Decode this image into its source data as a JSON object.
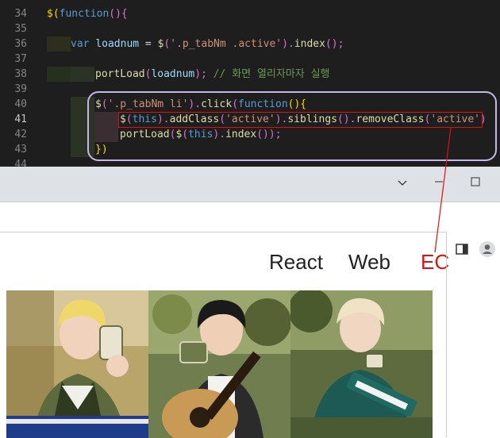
{
  "editor": {
    "line_numbers": [
      "34",
      "35",
      "36",
      "37",
      "38",
      "39",
      "40",
      "41",
      "42",
      "43",
      "44"
    ],
    "line34": {
      "a": "$",
      "b": "(",
      "c": "function",
      "d": "(){"
    },
    "line36": {
      "a": "var",
      "b": "loadnum",
      "c": " = ",
      "d": "$",
      "e": "(",
      "f": "'.p_tabNm .active'",
      "g": ").",
      "h": "index",
      "i": "();"
    },
    "line38": {
      "a": "portLoad",
      "b": "(",
      "c": "loadnum",
      "d": ");",
      "e": " // 화면 열리자마자 실행"
    },
    "line40": {
      "a": "$",
      "b": "(",
      "c": "'.p_tabNm li'",
      "d": ").",
      "e": "click",
      "f": "(",
      "g": "function",
      "h": "(){"
    },
    "line41": {
      "a": "$",
      "b": "(",
      "c": "this",
      "d": ").",
      "e": "addClass",
      "f": "(",
      "g": "'active'",
      "h": ").",
      "i": "siblings",
      "j": "().",
      "k": "removeClass",
      "l": "(",
      "m": "'active'",
      "n": ")"
    },
    "line42": {
      "a": "portLoad",
      "b": "(",
      "c": "$",
      "d": "(",
      "e": "this",
      "f": ").",
      "g": "index",
      "h": "());"
    },
    "line43": {
      "a": "})"
    }
  },
  "browser": {
    "titlebar_icons": [
      "chevron-down-icon",
      "minimize-icon",
      "maximize-icon"
    ],
    "toolbar_icons": [
      "share-icon",
      "star-icon",
      "side-panel-icon",
      "profile-icon"
    ]
  },
  "page": {
    "tabs": [
      "React",
      "Web",
      "EC"
    ],
    "active_tab": "EC",
    "active_color": "#dd1111"
  },
  "annotation": {
    "highlight_color": "#e01010",
    "box_color": "#c5b8e8"
  }
}
